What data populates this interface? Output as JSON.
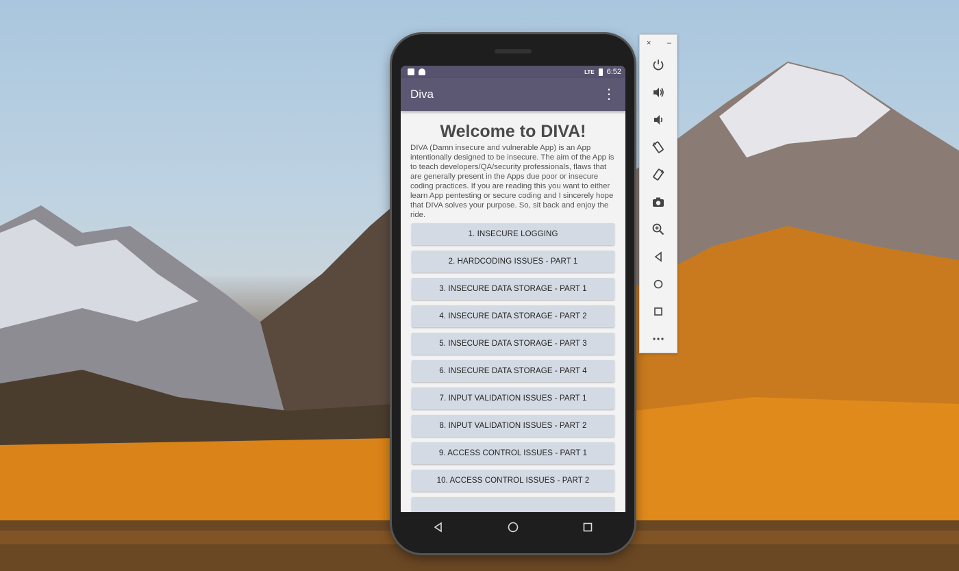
{
  "status_bar": {
    "time": "6:52",
    "network": "LTE"
  },
  "app_bar": {
    "title": "Diva",
    "menu_label": "⋮"
  },
  "welcome": {
    "heading": "Welcome to DIVA!",
    "text": "DIVA (Damn insecure and vulnerable App) is an App intentionally designed to be insecure. The aim of the App is to teach developers/QA/security professionals, flaws that are generally present in the Apps due poor or insecure coding practices. If you are reading this you want to either learn App pentesting or secure coding and I sincerely hope that DIVA solves your purpose. So, sit back and enjoy the ride."
  },
  "challenges": [
    "1. INSECURE LOGGING",
    "2. HARDCODING ISSUES - PART 1",
    "3. INSECURE DATA STORAGE - PART 1",
    "4. INSECURE DATA STORAGE - PART 2",
    "5. INSECURE DATA STORAGE - PART 3",
    "6. INSECURE DATA STORAGE - PART 4",
    "7. INPUT VALIDATION ISSUES - PART 1",
    "8. INPUT VALIDATION ISSUES - PART 2",
    "9. ACCESS CONTROL ISSUES - PART 1",
    "10. ACCESS CONTROL ISSUES - PART 2"
  ],
  "emulator_toolbar": {
    "close_label": "×",
    "minimize_label": "–",
    "buttons": [
      "power-icon",
      "volume-up-icon",
      "volume-down-icon",
      "rotate-left-icon",
      "rotate-right-icon",
      "camera-icon",
      "zoom-icon",
      "back-icon",
      "home-icon",
      "overview-icon",
      "more-icon"
    ]
  },
  "colors": {
    "status_bar": "#57526d",
    "app_bar": "#5c5874",
    "button_bg": "#d4dae3",
    "screen_bg": "#f3f3f3"
  }
}
